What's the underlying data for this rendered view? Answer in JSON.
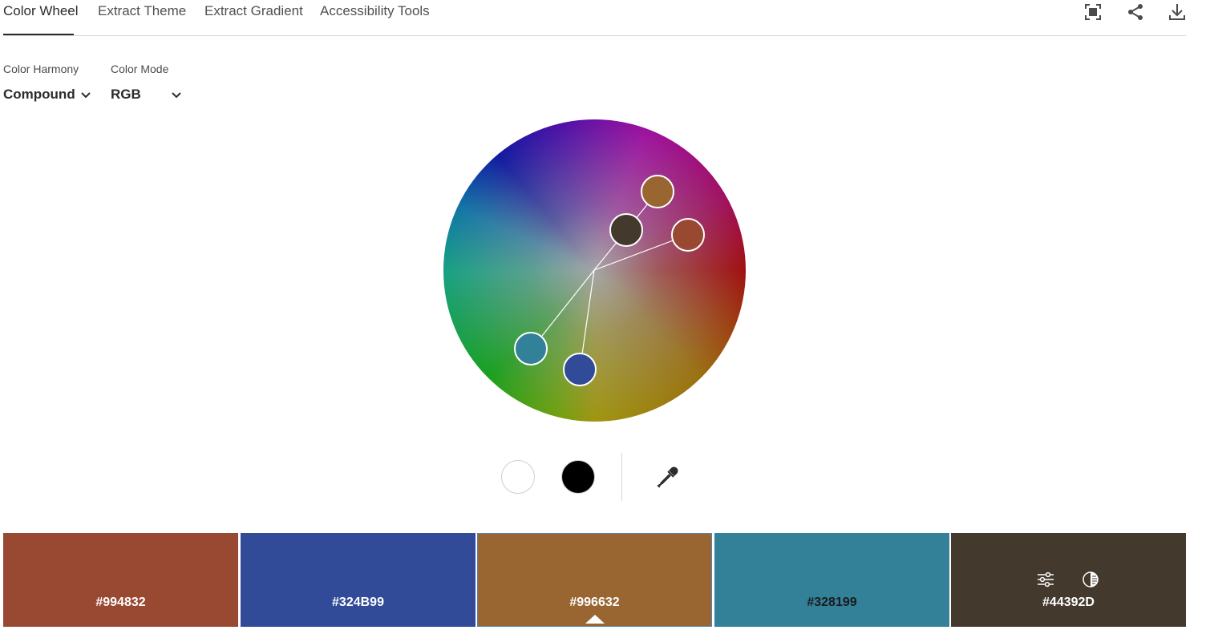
{
  "tabs": [
    {
      "label": "Color Wheel",
      "active": true
    },
    {
      "label": "Extract Theme",
      "active": false
    },
    {
      "label": "Extract Gradient",
      "active": false
    },
    {
      "label": "Accessibility Tools",
      "active": false
    }
  ],
  "toolbar_icons": [
    "fullscreen-icon",
    "share-icon",
    "download-icon"
  ],
  "controls": {
    "harmony": {
      "label": "Color Harmony",
      "value": "Compound"
    },
    "mode": {
      "label": "Color Mode",
      "value": "RGB"
    }
  },
  "wheel_markers": [
    {
      "color": "#994832"
    },
    {
      "color": "#324B99"
    },
    {
      "color": "#996632"
    },
    {
      "color": "#328199"
    },
    {
      "color": "#44392D"
    }
  ],
  "tools": [
    "white-brightness-icon",
    "black-brightness-icon",
    "eyedropper-icon"
  ],
  "swatches": [
    {
      "hex": "#994832",
      "color": "#994832",
      "text_color": "#ffffff",
      "selected": false
    },
    {
      "hex": "#324B99",
      "color": "#324B99",
      "text_color": "#ffffff",
      "selected": false
    },
    {
      "hex": "#996632",
      "color": "#996632",
      "text_color": "#ffffff",
      "selected": true
    },
    {
      "hex": "#328199",
      "color": "#328199",
      "text_color": "#1a1a1a",
      "selected": false
    },
    {
      "hex": "#44392D",
      "color": "#44392D",
      "text_color": "#ffffff",
      "selected": false
    }
  ],
  "swatch_icons": [
    "adjust-sliders-icon",
    "contrast-icon"
  ]
}
